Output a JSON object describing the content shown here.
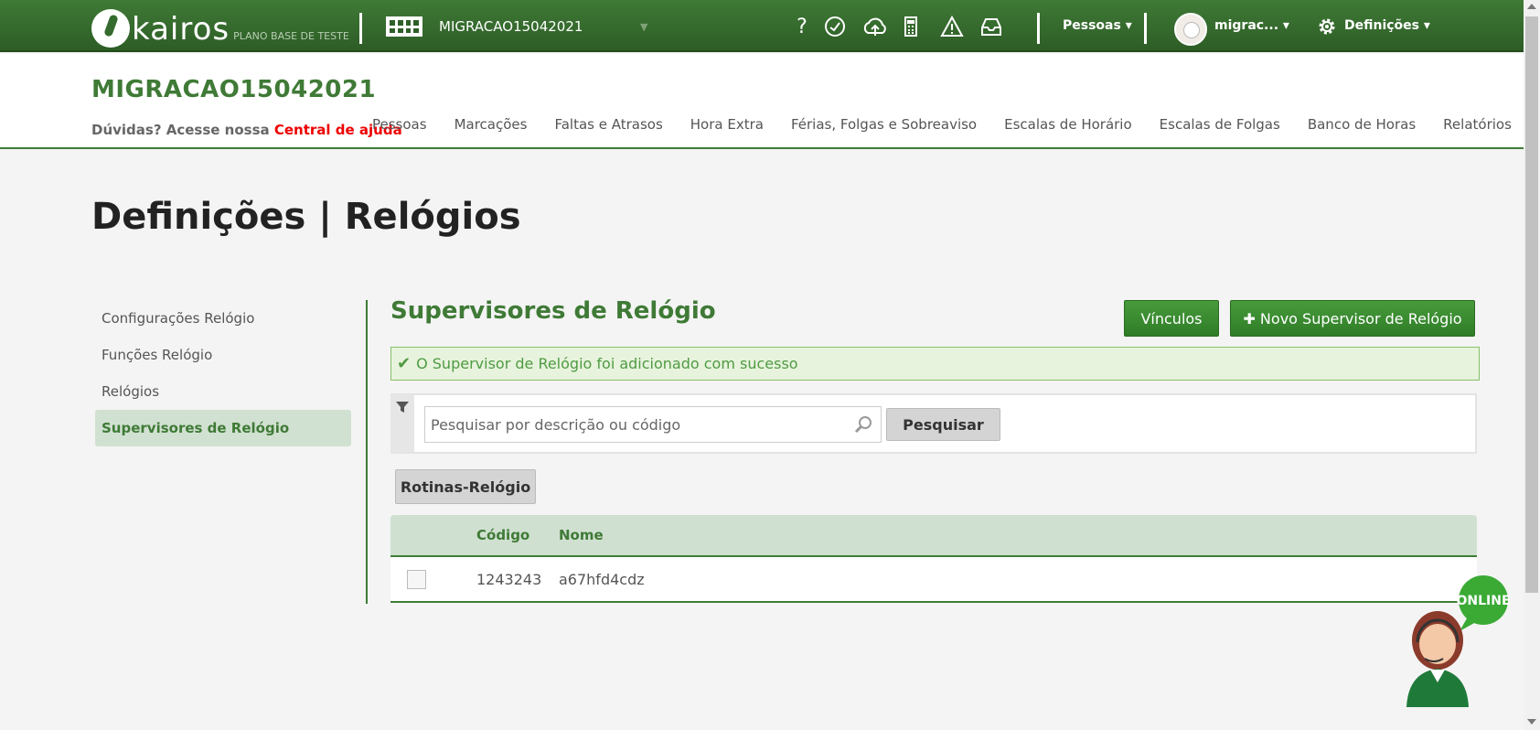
{
  "topbar": {
    "logo_text": "kairos",
    "logo_sub": "PLANO BASE DE TESTE",
    "company": "MIGRACAO15042021",
    "company_caret": "▼",
    "people_menu": "Pessoas ▾",
    "user_menu": "migrac... ▾",
    "settings_menu": "Definições ▾",
    "help_glyph": "?"
  },
  "header": {
    "company_title": "MIGRACAO15042021",
    "help_prefix": "Dúvidas? Acesse nossa ",
    "help_link": "Central de ajuda",
    "nav": [
      "Pessoas",
      "Marcações",
      "Faltas e Atrasos",
      "Hora Extra",
      "Férias, Folgas e Sobreaviso",
      "Escalas de Horário",
      "Escalas de Folgas",
      "Banco de Horas",
      "Relatórios"
    ]
  },
  "page_title": "Definições | Relógios",
  "sidebar": {
    "items": [
      {
        "label": "Configurações Relógio"
      },
      {
        "label": "Funções Relógio"
      },
      {
        "label": "Relógios"
      },
      {
        "label": "Supervisores de Relógio"
      }
    ]
  },
  "main": {
    "section_title": "Supervisores de Relógio",
    "links_button": "Vínculos",
    "new_button": "✚ Novo Supervisor de Relógio",
    "alert_check": "✔",
    "alert": "O Supervisor de Relógio foi adicionado com sucesso",
    "search_placeholder": "Pesquisar por descrição ou código",
    "search_button": "Pesquisar",
    "routines_button": "Rotinas-Relógio",
    "table": {
      "headers": [
        "Código",
        "Nome"
      ],
      "rows": [
        {
          "code": "1243243",
          "name": "a67hfd4cdz"
        }
      ]
    },
    "chat_badge": "ONLINE"
  },
  "colors": {
    "brand_green": "#3f7a36",
    "button_green": "#2f7d27",
    "alert_bg": "#e7f3dd",
    "link_red": "#e00000"
  }
}
